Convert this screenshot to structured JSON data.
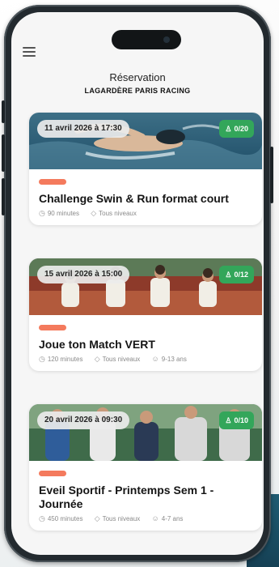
{
  "header": {
    "title": "Réservation",
    "subtitle": "LAGARDÈRE PARIS RACING",
    "menu_icon": "hamburger-menu-icon"
  },
  "colors": {
    "count_badge": "#33a65a",
    "tag": "#f47a5d",
    "corner_accent": "#1f5c73"
  },
  "cards": [
    {
      "date": "11 avril 2026 à 17:30",
      "count": "0/20",
      "tag": "",
      "title": "Challenge Swin & Run format court",
      "meta": [
        {
          "icon": "clock-icon",
          "text": "90 minutes"
        },
        {
          "icon": "level-diamond-icon",
          "text": "Tous niveaux"
        }
      ]
    },
    {
      "date": "15 avril 2026 à 15:00",
      "count": "0/12",
      "tag": "",
      "title": "Joue ton Match VERT",
      "meta": [
        {
          "icon": "clock-icon",
          "text": "120 minutes"
        },
        {
          "icon": "level-diamond-icon",
          "text": "Tous niveaux"
        },
        {
          "icon": "person-icon",
          "text": "9-13 ans"
        }
      ]
    },
    {
      "date": "20 avril 2026 à 09:30",
      "count": "0/10",
      "tag": "",
      "title": "Eveil Sportif - Printemps Sem 1 - Journée",
      "meta": [
        {
          "icon": "clock-icon",
          "text": "450 minutes"
        },
        {
          "icon": "level-diamond-icon",
          "text": "Tous niveaux"
        },
        {
          "icon": "person-icon",
          "text": "4-7 ans"
        }
      ]
    }
  ]
}
